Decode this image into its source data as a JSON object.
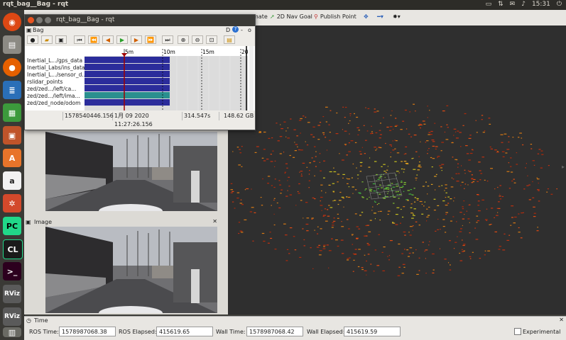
{
  "top_bar": {
    "title": "rqt_bag__Bag - rqt",
    "clock": "15:31"
  },
  "rviz_toolbar": {
    "nav_goal": "2D Nav Goal",
    "publish_point": "Publish Point",
    "estimate_partial": "mate"
  },
  "bag_window": {
    "title": "rqt_bag__Bag - rqt",
    "plugin_label": "Bag",
    "plugin_controls": "D",
    "timeline_ticks": [
      "5m",
      "10m",
      "15m",
      "20"
    ],
    "topics": [
      "Inertial_L.../gps_data",
      "Inertial_Labs/ins_data",
      "Inertial_L.../sensor_d...",
      "rslidar_points",
      "zed/zed.../left/ca...",
      "zed/zed.../left/ima...",
      "zed/zed_node/odom"
    ],
    "status": {
      "timestamp": "1578540446.156",
      "date": "1月 09 2020 11:27:26.156",
      "duration": "314.547s",
      "size": "148.62 GB"
    }
  },
  "image_panel": {
    "title": "Image"
  },
  "time_panel": {
    "title": "Time",
    "ros_time_label": "ROS Time:",
    "ros_time": "1578987068.38",
    "ros_elapsed_label": "ROS Elapsed:",
    "ros_elapsed": "415619.65",
    "wall_time_label": "Wall Time:",
    "wall_time": "1578987068.42",
    "wall_elapsed_label": "Wall Elapsed:",
    "wall_elapsed": "415619.59",
    "experimental_label": "Experimental"
  },
  "launcher_icons": [
    "ubuntu-icon",
    "files-icon",
    "firefox-icon",
    "writer-icon",
    "calc-icon",
    "impress-icon",
    "software-icon",
    "amazon-icon",
    "settings-icon",
    "pycharm-icon",
    "clion-icon",
    "terminal-icon",
    "rviz-icon",
    "rviz-icon-2",
    "trash-icon"
  ]
}
